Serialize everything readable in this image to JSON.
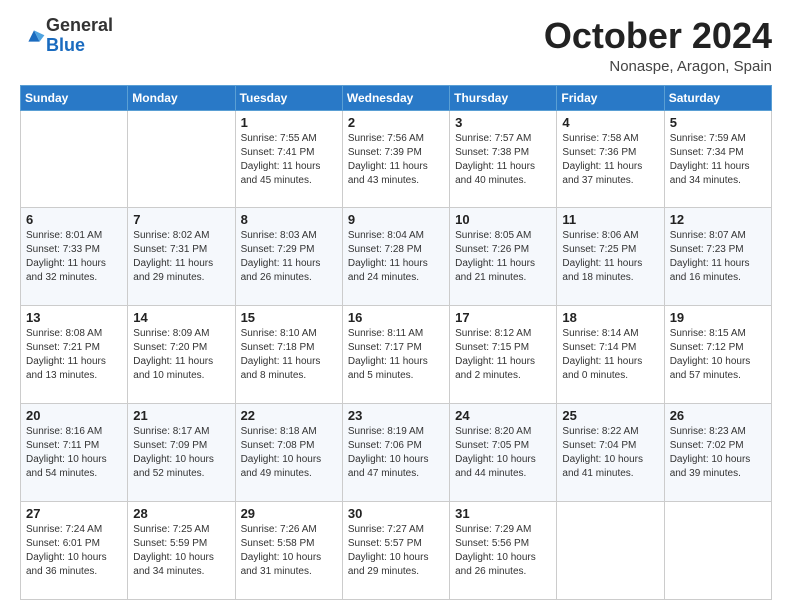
{
  "logo": {
    "general": "General",
    "blue": "Blue"
  },
  "title": "October 2024",
  "location": "Nonaspe, Aragon, Spain",
  "days_of_week": [
    "Sunday",
    "Monday",
    "Tuesday",
    "Wednesday",
    "Thursday",
    "Friday",
    "Saturday"
  ],
  "weeks": [
    [
      {
        "day": "",
        "info": ""
      },
      {
        "day": "",
        "info": ""
      },
      {
        "day": "1",
        "info": "Sunrise: 7:55 AM\nSunset: 7:41 PM\nDaylight: 11 hours and 45 minutes."
      },
      {
        "day": "2",
        "info": "Sunrise: 7:56 AM\nSunset: 7:39 PM\nDaylight: 11 hours and 43 minutes."
      },
      {
        "day": "3",
        "info": "Sunrise: 7:57 AM\nSunset: 7:38 PM\nDaylight: 11 hours and 40 minutes."
      },
      {
        "day": "4",
        "info": "Sunrise: 7:58 AM\nSunset: 7:36 PM\nDaylight: 11 hours and 37 minutes."
      },
      {
        "day": "5",
        "info": "Sunrise: 7:59 AM\nSunset: 7:34 PM\nDaylight: 11 hours and 34 minutes."
      }
    ],
    [
      {
        "day": "6",
        "info": "Sunrise: 8:01 AM\nSunset: 7:33 PM\nDaylight: 11 hours and 32 minutes."
      },
      {
        "day": "7",
        "info": "Sunrise: 8:02 AM\nSunset: 7:31 PM\nDaylight: 11 hours and 29 minutes."
      },
      {
        "day": "8",
        "info": "Sunrise: 8:03 AM\nSunset: 7:29 PM\nDaylight: 11 hours and 26 minutes."
      },
      {
        "day": "9",
        "info": "Sunrise: 8:04 AM\nSunset: 7:28 PM\nDaylight: 11 hours and 24 minutes."
      },
      {
        "day": "10",
        "info": "Sunrise: 8:05 AM\nSunset: 7:26 PM\nDaylight: 11 hours and 21 minutes."
      },
      {
        "day": "11",
        "info": "Sunrise: 8:06 AM\nSunset: 7:25 PM\nDaylight: 11 hours and 18 minutes."
      },
      {
        "day": "12",
        "info": "Sunrise: 8:07 AM\nSunset: 7:23 PM\nDaylight: 11 hours and 16 minutes."
      }
    ],
    [
      {
        "day": "13",
        "info": "Sunrise: 8:08 AM\nSunset: 7:21 PM\nDaylight: 11 hours and 13 minutes."
      },
      {
        "day": "14",
        "info": "Sunrise: 8:09 AM\nSunset: 7:20 PM\nDaylight: 11 hours and 10 minutes."
      },
      {
        "day": "15",
        "info": "Sunrise: 8:10 AM\nSunset: 7:18 PM\nDaylight: 11 hours and 8 minutes."
      },
      {
        "day": "16",
        "info": "Sunrise: 8:11 AM\nSunset: 7:17 PM\nDaylight: 11 hours and 5 minutes."
      },
      {
        "day": "17",
        "info": "Sunrise: 8:12 AM\nSunset: 7:15 PM\nDaylight: 11 hours and 2 minutes."
      },
      {
        "day": "18",
        "info": "Sunrise: 8:14 AM\nSunset: 7:14 PM\nDaylight: 11 hours and 0 minutes."
      },
      {
        "day": "19",
        "info": "Sunrise: 8:15 AM\nSunset: 7:12 PM\nDaylight: 10 hours and 57 minutes."
      }
    ],
    [
      {
        "day": "20",
        "info": "Sunrise: 8:16 AM\nSunset: 7:11 PM\nDaylight: 10 hours and 54 minutes."
      },
      {
        "day": "21",
        "info": "Sunrise: 8:17 AM\nSunset: 7:09 PM\nDaylight: 10 hours and 52 minutes."
      },
      {
        "day": "22",
        "info": "Sunrise: 8:18 AM\nSunset: 7:08 PM\nDaylight: 10 hours and 49 minutes."
      },
      {
        "day": "23",
        "info": "Sunrise: 8:19 AM\nSunset: 7:06 PM\nDaylight: 10 hours and 47 minutes."
      },
      {
        "day": "24",
        "info": "Sunrise: 8:20 AM\nSunset: 7:05 PM\nDaylight: 10 hours and 44 minutes."
      },
      {
        "day": "25",
        "info": "Sunrise: 8:22 AM\nSunset: 7:04 PM\nDaylight: 10 hours and 41 minutes."
      },
      {
        "day": "26",
        "info": "Sunrise: 8:23 AM\nSunset: 7:02 PM\nDaylight: 10 hours and 39 minutes."
      }
    ],
    [
      {
        "day": "27",
        "info": "Sunrise: 7:24 AM\nSunset: 6:01 PM\nDaylight: 10 hours and 36 minutes."
      },
      {
        "day": "28",
        "info": "Sunrise: 7:25 AM\nSunset: 5:59 PM\nDaylight: 10 hours and 34 minutes."
      },
      {
        "day": "29",
        "info": "Sunrise: 7:26 AM\nSunset: 5:58 PM\nDaylight: 10 hours and 31 minutes."
      },
      {
        "day": "30",
        "info": "Sunrise: 7:27 AM\nSunset: 5:57 PM\nDaylight: 10 hours and 29 minutes."
      },
      {
        "day": "31",
        "info": "Sunrise: 7:29 AM\nSunset: 5:56 PM\nDaylight: 10 hours and 26 minutes."
      },
      {
        "day": "",
        "info": ""
      },
      {
        "day": "",
        "info": ""
      }
    ]
  ]
}
